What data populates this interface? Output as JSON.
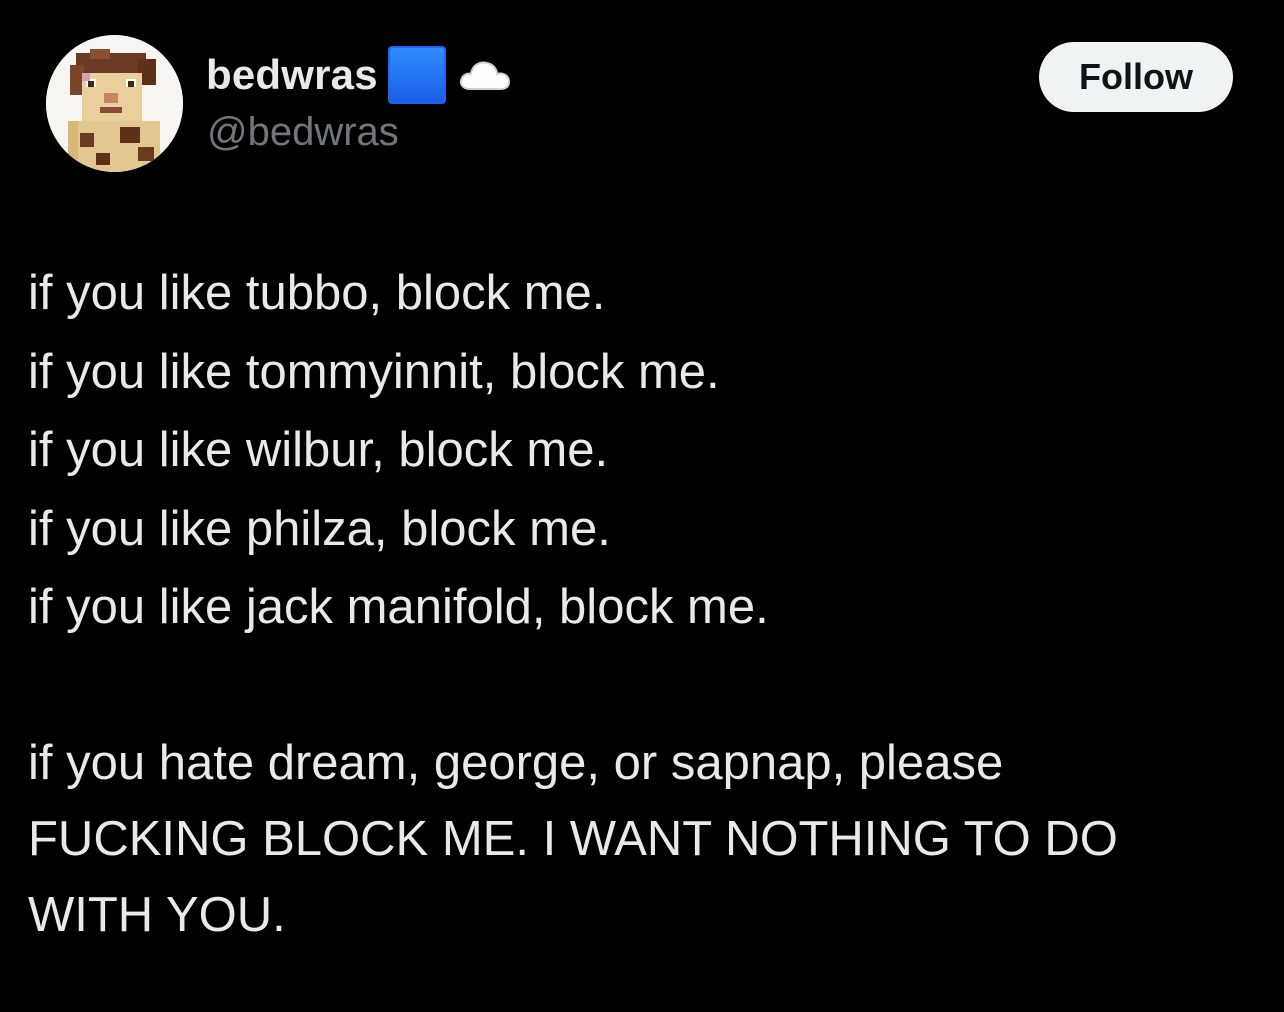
{
  "tweet": {
    "author": {
      "display_name": "bedwras",
      "handle": "@bedwras",
      "avatar_icon": "minecraft-skin-avatar",
      "name_emojis": [
        "blue-square-icon",
        "cloud-icon"
      ]
    },
    "follow_label": "Follow",
    "body_lines": [
      "if you like tubbo, block me.",
      "if you like tommyinnit, block me.",
      "if you like wilbur, block me.",
      "if you like philza, block me.",
      "if you like jack manifold, block me."
    ],
    "tail_lines": [
      "if you hate dream, george, or sapnap, please",
      "FUCKING BLOCK ME. I WANT NOTHING TO DO",
      "WITH YOU."
    ]
  },
  "colors": {
    "background": "#000000",
    "text_primary": "#e7e9ea",
    "text_secondary": "#71767b",
    "follow_bg": "#eff3f4",
    "follow_text": "#0f1419",
    "blue_square": "#1a6bf5"
  }
}
